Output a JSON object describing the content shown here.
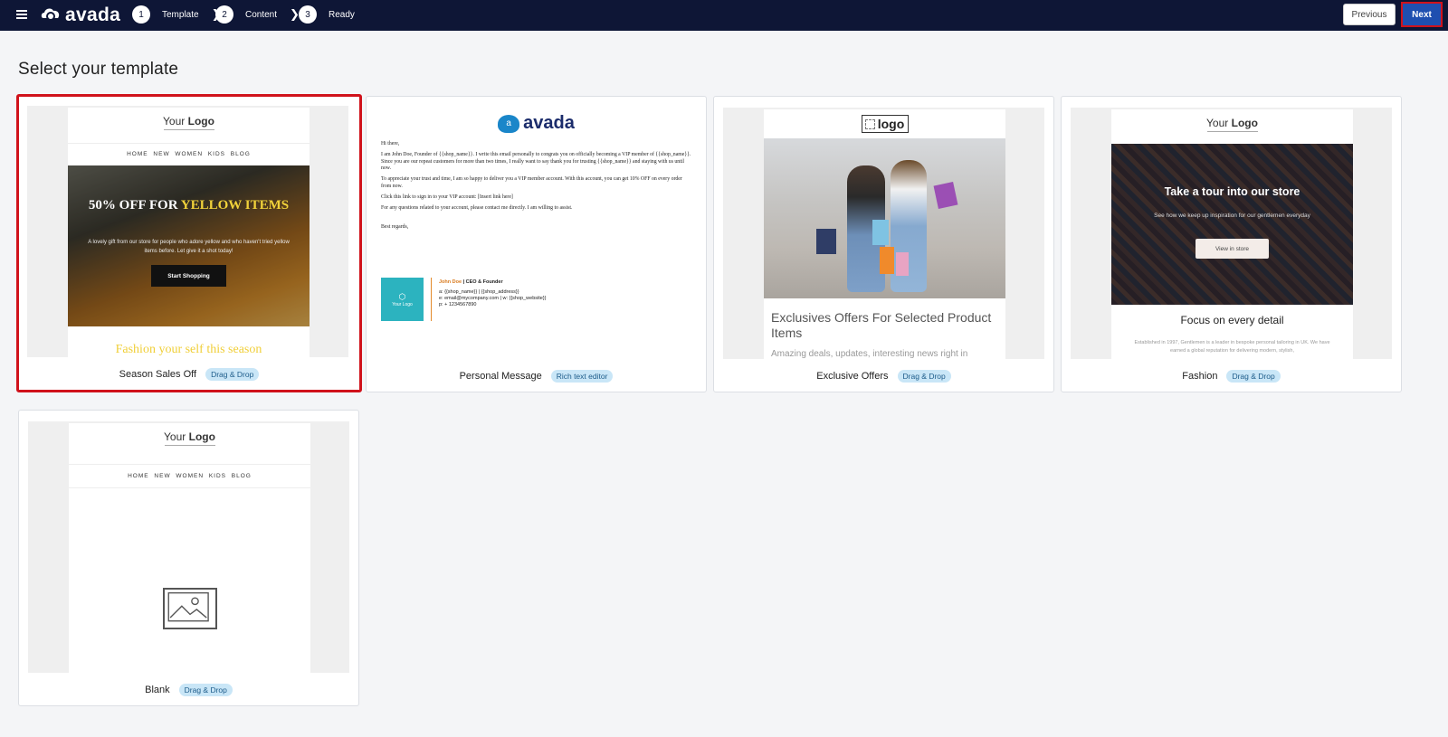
{
  "app": {
    "brand": "avada",
    "menu_icon": "hamburger-icon"
  },
  "steps": [
    {
      "number": "1",
      "label": "Template"
    },
    {
      "number": "2",
      "label": "Content"
    },
    {
      "number": "3",
      "label": "Ready"
    }
  ],
  "nav": {
    "previous_label": "Previous",
    "next_label": "Next"
  },
  "page": {
    "title": "Select your template"
  },
  "colors": {
    "topbar": "#0e1636",
    "accent": "#1e4fb0",
    "selection": "#d0121b",
    "badge_bg": "#c9e6f7"
  },
  "templates": [
    {
      "name": "Season Sales Off",
      "badge": "Drag & Drop",
      "selected": true,
      "preview": {
        "logo_your": "Your",
        "logo_bold": "Logo",
        "nav": "HOME NEW WOMEN KIDS BLOG",
        "headline_white": "50% OFF FOR",
        "headline_yellow": "YELLOW ITEMS",
        "body": "A lovely gift from our store for people who adore yellow and who haven't tried yellow items before. Let give it a shot today!",
        "button": "Start Shopping",
        "footer": "Fashion your self this season"
      }
    },
    {
      "name": "Personal Message",
      "badge": "Rich text editor",
      "selected": false,
      "preview": {
        "brand": "avada",
        "brand_mark": "a",
        "greeting": "Hi there,",
        "p1": "I am John Doe, Founder of {{shop_name}}. I write this email personally to congrats you on officially becoming a VIP member of {{shop_name}}.",
        "p1b": "Since you are our repeat customers for more than two times, I really want to say thank you for trusting {{shop_name}} and staying with us until now.",
        "p2": "To appreciate your trust and time, I am so happy to deliver you a VIP member account. With this account, you can get 10% OFF on every order from now.",
        "p3": "Click this link to sign in to your VIP account: [Insert link here]",
        "p4": "For any questions related to your account, please contact me directly. I am willing to assist.",
        "closing": "Best regards,",
        "sig_logo": "Your Logo",
        "sig_name": "John Doe",
        "sig_role": "| CEO & Founder",
        "sig_line1": "a: {{shop_name}} | {{shop_address}}",
        "sig_line2": "e: email@mycompany.com | w: {{shop_website}}",
        "sig_line3": "p: + 1234567890"
      }
    },
    {
      "name": "Exclusive Offers",
      "badge": "Drag & Drop",
      "selected": false,
      "preview": {
        "logo": "logo",
        "title": "Exclusives Offers For Selected Product Items",
        "subtitle": "Amazing deals, updates, interesting news right in"
      }
    },
    {
      "name": "Fashion",
      "badge": "Drag & Drop",
      "selected": false,
      "preview": {
        "logo_your": "Your",
        "logo_bold": "Logo",
        "headline": "Take a tour into our store",
        "sub": "See how we keep up inspiration for our gentlemen everyday",
        "button": "View in store",
        "focus": "Focus on every detail",
        "text": "Established in 1997, Gentlemen is a leader in bespoke personal tailoring in UK. We have earned a global reputation for delivering modern, stylish,"
      }
    },
    {
      "name": "Blank",
      "badge": "Drag & Drop",
      "selected": false,
      "preview": {
        "logo_your": "Your",
        "logo_bold": "Logo",
        "nav": "HOME NEW WOMEN KIDS BLOG",
        "image_icon": "image-placeholder-icon"
      }
    }
  ]
}
